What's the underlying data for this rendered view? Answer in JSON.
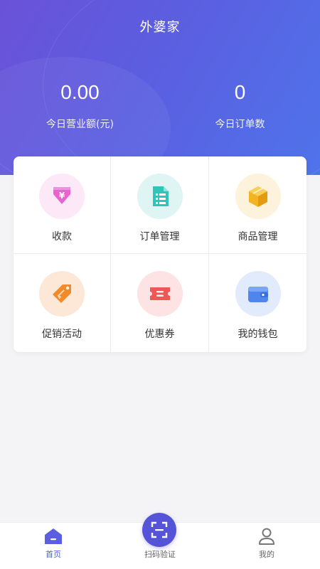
{
  "header": {
    "title": "外婆家"
  },
  "stats": [
    {
      "value": "0.00",
      "label": "今日营业额(元)"
    },
    {
      "value": "0",
      "label": "今日订单数"
    }
  ],
  "grid": [
    {
      "label": "收款",
      "icon": "payment-yen-icon",
      "color": "#e05fc9"
    },
    {
      "label": "订单管理",
      "icon": "order-document-icon",
      "color": "#2ec6b9"
    },
    {
      "label": "商品管理",
      "icon": "product-box-icon",
      "color": "#f2b422"
    },
    {
      "label": "促销活动",
      "icon": "promotion-tag-icon",
      "color": "#f08a2a"
    },
    {
      "label": "优惠券",
      "icon": "coupon-ticket-icon",
      "color": "#ef5656"
    },
    {
      "label": "我的钱包",
      "icon": "wallet-icon",
      "color": "#4f86ee"
    }
  ],
  "tabbar": {
    "items": [
      {
        "label": "首页",
        "icon": "home-icon",
        "active": true
      },
      {
        "label": "扫码验证",
        "icon": "scan-icon"
      },
      {
        "label": "我的",
        "icon": "user-icon"
      }
    ]
  },
  "colors": {
    "accent": "#5553d8",
    "header_from": "#6a52d8",
    "header_to": "#4f73ea"
  }
}
